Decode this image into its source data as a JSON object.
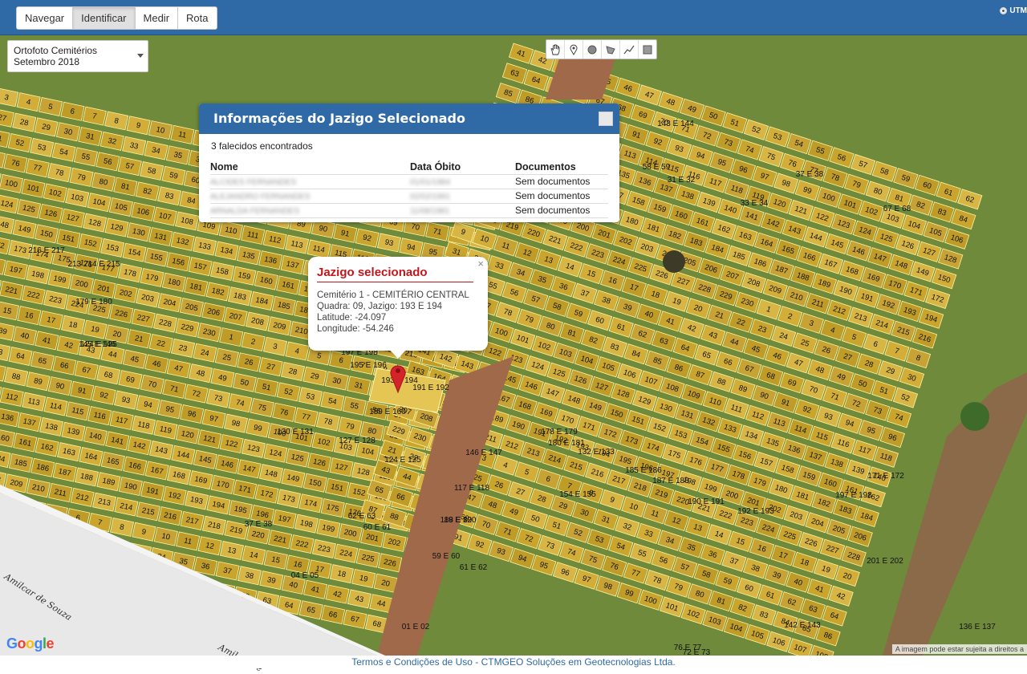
{
  "toolbar": {
    "buttons": [
      "Navegar",
      "Identificar",
      "Medir",
      "Rota"
    ],
    "active": "Identificar",
    "projection_label": "UTM"
  },
  "layer": {
    "selected": "Ortofoto Cemitérios Setembro 2018"
  },
  "draw_tools": [
    "hand-icon",
    "marker-icon",
    "circle-icon",
    "polygon-icon",
    "polyline-icon",
    "rectangle-icon"
  ],
  "info_panel": {
    "title": "Informações do Jazigo Selecionado",
    "count_text": "3 falecidos encontrados",
    "columns": [
      "Nome",
      "Data Óbito",
      "Documentos"
    ],
    "rows": [
      {
        "name": "ALCIDES FERNANDES",
        "date": "01/01/1984",
        "docs": "Sem documentos"
      },
      {
        "name": "ALEJANDRO FERNANDES",
        "date": "02/02/1991",
        "docs": "Sem documentos"
      },
      {
        "name": "ARNALDA FERNANDES",
        "date": "11/08/1981",
        "docs": "Sem documentos"
      }
    ]
  },
  "popup": {
    "title": "Jazigo selecionado",
    "line1": "Cemitério 1 - CEMITÉRIO CENTRAL",
    "line2": "Quadra: 09, Jazigo: 193 E 194",
    "line3": "Latitude: -24.097",
    "line4": "Longitude: -54.246",
    "close": "×"
  },
  "map": {
    "street_1": "Amilcar de Souza",
    "street_2": "Amilcar de",
    "google_logo": "Google",
    "attribution": "A imagem pode estar sujeita a direitos a",
    "plot_labels": [
      "193 E 194",
      "191 E 192",
      "197 E 198",
      "195 E 196",
      "159 E 160",
      "127 E 128",
      "124 E 125",
      "62 E 63",
      "60 E 61",
      "130 E 131",
      "37 E 38",
      "04 E 05",
      "01 E 02",
      "59 E 60",
      "61 E 62",
      "146 E 147",
      "132 E 133",
      "185 E 186",
      "187 E 188",
      "154 E 155",
      "190 E 191",
      "192 E 193",
      "117 E 118",
      "119 E 120",
      "88 E 89",
      "178 E 179",
      "180 E 181",
      "142 E 143",
      "136 E 137",
      "201 E 202",
      "197 E 198",
      "171 E 172",
      "72 E 73",
      "76 E 77",
      "213 214 E 215",
      "216 E 217",
      "179 E 180",
      "124 E 125",
      "145 E 146",
      "143 E 144",
      "58 E 59",
      "31 E 32",
      "33 E 34",
      "37 E 38",
      "67 E 68",
      "72 73 E 74"
    ],
    "colors": {
      "plot": "#c9a52e",
      "grass": "#6f8a3a",
      "road": "#a0694a",
      "street": "#e8e8e8"
    }
  },
  "footer": {
    "text": "Termos e Condições de Uso - CTMGEO Soluções em Geotecnologias Ltda."
  }
}
